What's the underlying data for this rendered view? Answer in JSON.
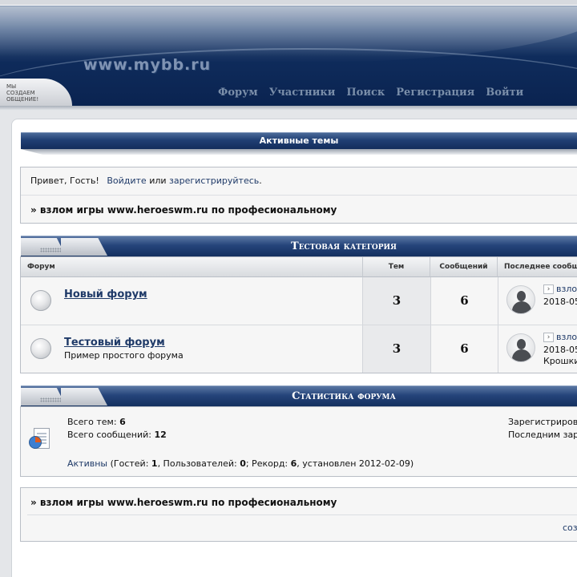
{
  "header": {
    "logo_text": "www.mybb.ru",
    "slogan_lines": [
      "Мы",
      "создаем",
      "общение!"
    ],
    "nav": [
      "Форум",
      "Участники",
      "Поиск",
      "Регистрация",
      "Войти"
    ]
  },
  "active_topics": {
    "title": "Активные темы"
  },
  "welcome": {
    "greeting": "Привет, Гость!",
    "login_link": "Войдите",
    "or": "или",
    "register_link": "зарегистрируйтесь",
    "period": ".",
    "announcement": "» взлом игры www.heroeswm.ru по професиональному"
  },
  "category": {
    "title": "Тестовая категория",
    "columns": {
      "forum": "Форум",
      "topics": "Тем",
      "posts": "Сообщений",
      "last": "Последнее сообщение"
    },
    "forums": [
      {
        "name": "Новый форум",
        "description": "",
        "topics": "3",
        "posts": "6",
        "last_link": "взлом",
        "last_date": "2018-05",
        "last_user": ""
      },
      {
        "name": "Тестовый форум",
        "description": "Пример простого форума",
        "topics": "3",
        "posts": "6",
        "last_link": "взлом",
        "last_date": "2018-05",
        "last_user": "Крошки"
      }
    ]
  },
  "stats": {
    "title": "Статистика форума",
    "total_topics_label": "Всего тем:",
    "total_topics": "6",
    "total_posts_label": "Всего сообщений:",
    "total_posts": "12",
    "registered_label": "Зарегистрирова",
    "last_registered_label": "Последним зар",
    "active_link": "Активны",
    "online_prefix": "(Гостей:",
    "guests": "1",
    "users_label": ", Пользователей:",
    "users": "0",
    "record_label": "; Рекорд:",
    "record": "6",
    "record_suffix": ", установлен 2012-02-09)"
  },
  "footer": {
    "announcement": "» взлом игры www.heroeswm.ru по професиональному",
    "link": "соз"
  }
}
